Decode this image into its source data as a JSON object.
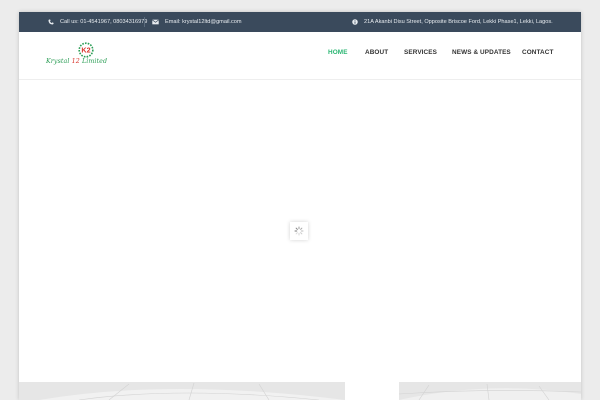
{
  "topbar": {
    "phone_icon": "phone-icon",
    "phone_text": "Call us: 01-4541967, 08034316979",
    "email_icon": "envelope-icon",
    "email_text": "Email: krystal12ltd@gmail.com",
    "address_icon": "info-circle-icon",
    "address_text": "21A Akanbi Disu Street, Opposite Briscoe Ford, Lekki Phase1, Lekki, Lagos.",
    "background_color": "#3a4a5c"
  },
  "logo": {
    "emblem_text": "K2",
    "word_1": "Krystal",
    "word_2": "12",
    "word_3": "Limited",
    "text_color": "#2a9d55",
    "accent_color": "#d9342b"
  },
  "nav": {
    "items": [
      {
        "label": "HOME",
        "active": true
      },
      {
        "label": "ABOUT",
        "active": false
      },
      {
        "label": "SERVICES",
        "active": false
      },
      {
        "label": "NEWS & UPDATES",
        "active": false
      },
      {
        "label": "CONTACT",
        "active": false
      }
    ],
    "active_color": "#2bb673"
  },
  "slider": {
    "loading_icon": "spinner-icon"
  }
}
